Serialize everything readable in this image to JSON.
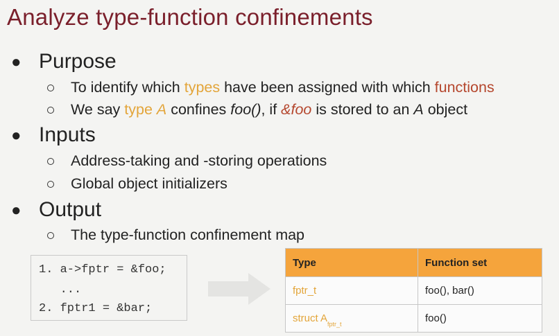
{
  "title": "Analyze type-function confinements",
  "sections": [
    {
      "heading": "Purpose"
    },
    {
      "heading": "Inputs"
    },
    {
      "heading": "Output"
    }
  ],
  "purpose": {
    "item1": {
      "pre": "To identify which ",
      "types": "types",
      "mid": " have been assigned with which ",
      "functions": "functions"
    },
    "item2": {
      "pre": "We say ",
      "type_a": "type A",
      "mid1": " confines ",
      "foo": "foo()",
      "mid2": ", if ",
      "addr": "&foo",
      "mid3": " is stored to an ",
      "a": "A",
      "post": " object"
    }
  },
  "inputs": [
    "Address-taking and -storing operations",
    "Global object initializers"
  ],
  "output": [
    "The type-function confinement map"
  ],
  "code": [
    "1. a->fptr = &foo;",
    "   ...",
    "2. fptr1 = &bar;"
  ],
  "table": {
    "headers": [
      "Type",
      "Function set"
    ],
    "rows": [
      {
        "type": "fptr_t",
        "functions": "foo(), bar()"
      },
      {
        "type": "struct A",
        "sub": "fptr_t",
        "functions": "foo()"
      }
    ]
  },
  "colors": {
    "title": "#7a1f2b",
    "type_highlight": "#e3a53a",
    "function_highlight": "#b5472e",
    "table_header": "#f5a43c"
  }
}
